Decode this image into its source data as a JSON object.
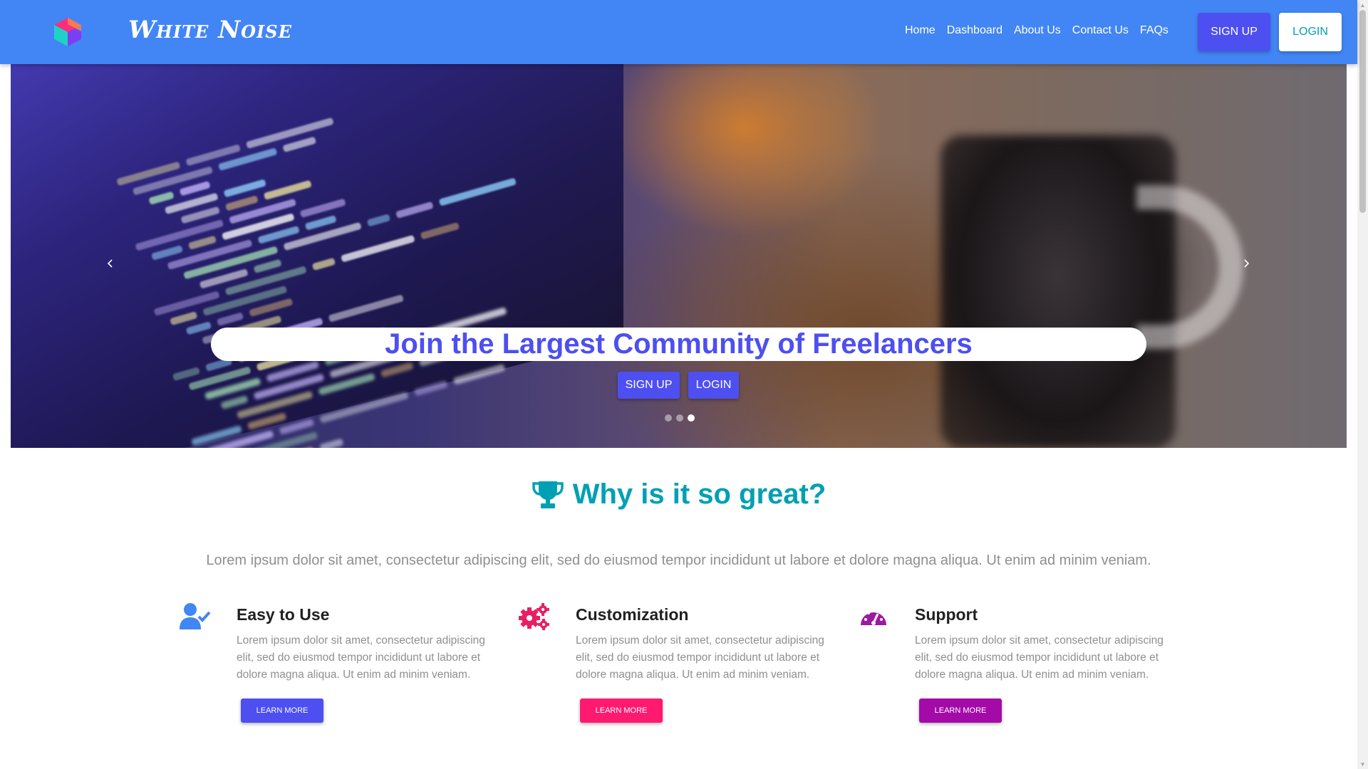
{
  "navbar": {
    "brand": "White Noise",
    "links": [
      "Home",
      "Dashboard",
      "About Us",
      "Contact Us",
      "FAQs"
    ],
    "signup_label": "SIGN UP",
    "login_label": "LOGIN",
    "color": "#4285f4"
  },
  "hero": {
    "title": "Join the Largest Community of Freelancers",
    "signup_label": "SIGN UP",
    "login_label": "LOGIN",
    "prev_icon": "chevron-left-icon",
    "next_icon": "chevron-right-icon",
    "slide_count": 3,
    "active_slide": 3,
    "title_color": "#4d4ff0"
  },
  "features": {
    "title": "Why is it so great?",
    "title_icon": "trophy-icon",
    "title_color": "#00a0b4",
    "description": "Lorem ipsum dolor sit amet, consectetur adipiscing elit, sed do eiusmod tempor incididunt ut labore et dolore magna aliqua. Ut enim ad minim veniam.",
    "items": [
      {
        "title": "Easy to Use",
        "icon": "user-check-icon",
        "text": "Lorem ipsum dolor sit amet, consectetur adipiscing elit, sed do eiusmod tempor incididunt ut labore et dolore magna aliqua. Ut enim ad minim veniam.",
        "button": "LEARN MORE",
        "color": "#4d4ff0"
      },
      {
        "title": "Customization",
        "icon": "gears-icon",
        "text": "Lorem ipsum dolor sit amet, consectetur adipiscing elit, sed do eiusmod tempor incididunt ut labore et dolore magna aliqua. Ut enim ad minim veniam.",
        "button": "LEARN MORE",
        "color": "#ff1a70"
      },
      {
        "title": "Support",
        "icon": "gauge-icon",
        "text": "Lorem ipsum dolor sit amet, consectetur adipiscing elit, sed do eiusmod tempor incididunt ut labore et dolore magna aliqua. Ut enim ad minim veniam.",
        "button": "LEARN MORE",
        "color": "#a30aa8"
      }
    ]
  }
}
